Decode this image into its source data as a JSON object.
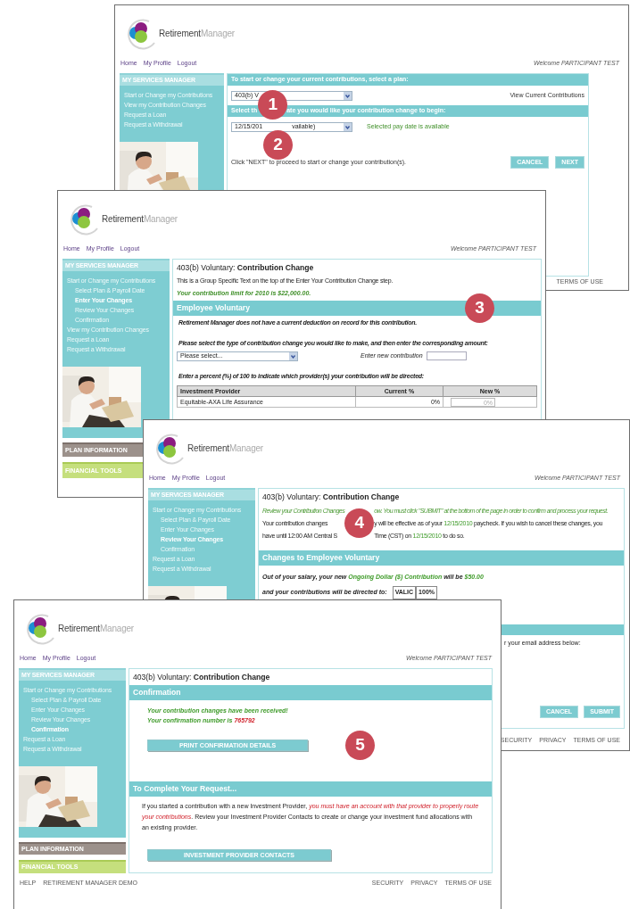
{
  "screens": [
    {
      "kind": "select_plan",
      "logo": {
        "primary": "Retirement",
        "secondary": "Manager"
      },
      "nav": [
        "Home",
        "My Profile",
        "Logout"
      ],
      "welcome": "Welcome PARTICIPANT TEST",
      "sidebar": {
        "header": "MY SERVICES MANAGER",
        "items": [
          {
            "label": "Start or Change my Contributions",
            "selected": false
          },
          {
            "label": "View my Contribution Changes",
            "selected": false
          },
          {
            "label": "Request a Loan",
            "selected": false
          },
          {
            "label": "Request a Withdrawal",
            "selected": false
          }
        ]
      },
      "content": {
        "plan_heading": "To start or change your current contributions, select a plan:",
        "plan_select": "403(b) V",
        "view_link": "View Current Contributions",
        "date_heading": {
          "before": "Select th",
          "marker": "1",
          "after": "ate you would like your contribution change to begin:"
        },
        "date_select": {
          "before": "12/15/201",
          "marker": "2",
          "after": "vailable)"
        },
        "date_status": "Selected pay date is available",
        "instructions": "Click \"NEXT\" to proceed to start or change your contribution(s).",
        "cancel_button": "CANCEL",
        "next_button": "NEXT"
      },
      "footer": {
        "right": [
          "TERMS OF USE"
        ]
      }
    },
    {
      "kind": "enter_changes",
      "logo": {
        "primary": "Retirement",
        "secondary": "Manager"
      },
      "nav": [
        "Home",
        "My Profile",
        "Logout"
      ],
      "welcome": "Welcome PARTICIPANT TEST",
      "sidebar": {
        "header": "MY SERVICES MANAGER",
        "items": [
          {
            "label": "Start or Change my Contributions",
            "selected": false,
            "children": [
              {
                "label": "Select Plan & Payroll Date",
                "selected": false
              },
              {
                "label": "Enter Your Changes",
                "selected": true
              },
              {
                "label": "Review Your Changes",
                "selected": false
              },
              {
                "label": "Confirmation",
                "selected": false
              }
            ]
          },
          {
            "label": "View my Contribution Changes",
            "selected": false
          },
          {
            "label": "Request a Loan",
            "selected": false
          },
          {
            "label": "Request a Withdrawal",
            "selected": false
          }
        ],
        "panels": [
          {
            "label": "PLAN INFORMATION",
            "kind": "plan"
          },
          {
            "label": "FINANCIAL TOOLS",
            "kind": "tools"
          }
        ]
      },
      "content": {
        "title": "403(b) Voluntary: **Contribution Change**",
        "group_text": "This is a Group Specific Text on the top of the Enter Your Contribution Change step.",
        "limit": "Your contribution limit for 2010 is $22,000.00.",
        "section": {
          "label": "Employee Voluntary",
          "marker": "3"
        },
        "notice": "Retirement Manager does not have a current deduction on record for this contribution.",
        "prompt": "Please select the type of contribution change you would like to make, and then enter the corresponding amount:",
        "type_select": "Please select...",
        "amount_label": "Enter new contribution",
        "percent_prompt": "Enter a percent (%) of 100 to indicate which provider(s) your contribution will be directed:",
        "table": {
          "columns": [
            "Investment Provider",
            "Current %",
            "New %"
          ],
          "rows": [
            [
              "Equitable-AXA Life Assurance",
              "0%",
              "0%"
            ]
          ]
        }
      }
    },
    {
      "kind": "review",
      "logo": {
        "primary": "Retirement",
        "secondary": "Manager"
      },
      "nav": [
        "Home",
        "My Profile",
        "Logout"
      ],
      "welcome": "Welcome PARTICIPANT TEST",
      "sidebar": {
        "header": "MY SERVICES MANAGER",
        "items": [
          {
            "label": "Start or Change my Contributions",
            "selected": false,
            "children": [
              {
                "label": "Select Plan & Payroll Date",
                "selected": false
              },
              {
                "label": "Enter Your Changes",
                "selected": false
              },
              {
                "label": "Review Your Changes",
                "selected": true
              },
              {
                "label": "Confirmation",
                "selected": false
              }
            ]
          },
          {
            "label": "Request a Loan",
            "selected": false
          },
          {
            "label": "Request a Withdrawal",
            "selected": false
          }
        ]
      },
      "content": {
        "title": "403(b) Voluntary: **Contribution Change**",
        "marker": "4",
        "rows": [
          {
            "kind": "note",
            "before": "Review your Contribution Changes",
            "after": [
              {
                "text": "ow. You must click \"SUBMIT\" at the bottom of the page in order to confirm and process your request.",
                "kind": "note"
              }
            ]
          },
          {
            "kind": "plain",
            "before": "Your contribution changes",
            "after": [
              {
                "text": "y will be effective as of your ",
                "kind": "plain"
              },
              {
                "text": "12/15/2010",
                "kind": "date"
              },
              {
                "text": " paycheck. If you wish to cancel these changes, you",
                "kind": "plain"
              }
            ]
          },
          {
            "kind": "plain",
            "before": "have until 12:00 AM Central S",
            "after": [
              {
                "text": "Time (CST) on ",
                "kind": "plain"
              },
              {
                "text": "12/15/2010",
                "kind": "date"
              },
              {
                "text": " to do so.",
                "kind": "plain"
              }
            ]
          }
        ],
        "section": "Changes to Employee Voluntary",
        "salary": [
          {
            "text": "Out of your salary, your new ",
            "kind": "plain"
          },
          {
            "text": "Ongoing Dollar ($) Contribution",
            "kind": "date"
          },
          {
            "text": " will be ",
            "kind": "plain"
          },
          {
            "text": "$50.00",
            "kind": "date"
          }
        ],
        "directed": {
          "label": "and your contributions will be directed to:",
          "cells": [
            "VALIC",
            "100%"
          ]
        },
        "email_hint": "r your email address below:",
        "cancel_button": "CANCEL",
        "submit_button": "SUBMIT"
      },
      "footer": {
        "right": [
          "SECURITY",
          "PRIVACY",
          "TERMS OF USE"
        ]
      }
    },
    {
      "kind": "confirmation",
      "logo": {
        "primary": "Retirement",
        "secondary": "Manager"
      },
      "nav": [
        "Home",
        "My Profile",
        "Logout"
      ],
      "welcome": "Welcome PARTICIPANT TEST",
      "sidebar": {
        "header": "MY SERVICES MANAGER",
        "items": [
          {
            "label": "Start or Change my Contributions",
            "selected": false,
            "children": [
              {
                "label": "Select Plan & Payroll Date",
                "selected": false
              },
              {
                "label": "Enter Your Changes",
                "selected": false
              },
              {
                "label": "Review Your Changes",
                "selected": false
              },
              {
                "label": "Confirmation",
                "selected": true
              }
            ]
          },
          {
            "label": "Request a Loan",
            "selected": false
          },
          {
            "label": "Request a Withdrawal",
            "selected": false
          }
        ],
        "panels": [
          {
            "label": "PLAN INFORMATION",
            "kind": "plan"
          },
          {
            "label": "FINANCIAL TOOLS",
            "kind": "tools"
          }
        ]
      },
      "content": {
        "title": "403(b) Voluntary: **Contribution Change**",
        "section": "Confirmation",
        "received": "Your contribution changes have been received!",
        "number": [
          {
            "text": "Your confirmation number is ",
            "kind": "plain"
          },
          {
            "text": "765792",
            "kind": "number"
          }
        ],
        "print_button": "PRINT CONFIRMATION DETAILS",
        "marker": "5",
        "section2": "To Complete Your Request...",
        "paragraph": [
          {
            "text": "If you started a contribution with a new Investment Provider, ",
            "kind": "plain"
          },
          {
            "text": "you must have an account with that provider to properly route your contributions",
            "kind": "alert"
          },
          {
            "text": ". Review your Investment Provider Contacts to create or change your investment fund allocations with an existing provider.",
            "kind": "plain"
          }
        ],
        "contacts_button": "INVESTMENT PROVIDER CONTACTS"
      },
      "footer": {
        "left": [
          "HELP",
          "RETIREMENT MANAGER DEMO"
        ],
        "right": [
          "SECURITY",
          "PRIVACY",
          "TERMS OF USE"
        ]
      }
    }
  ]
}
